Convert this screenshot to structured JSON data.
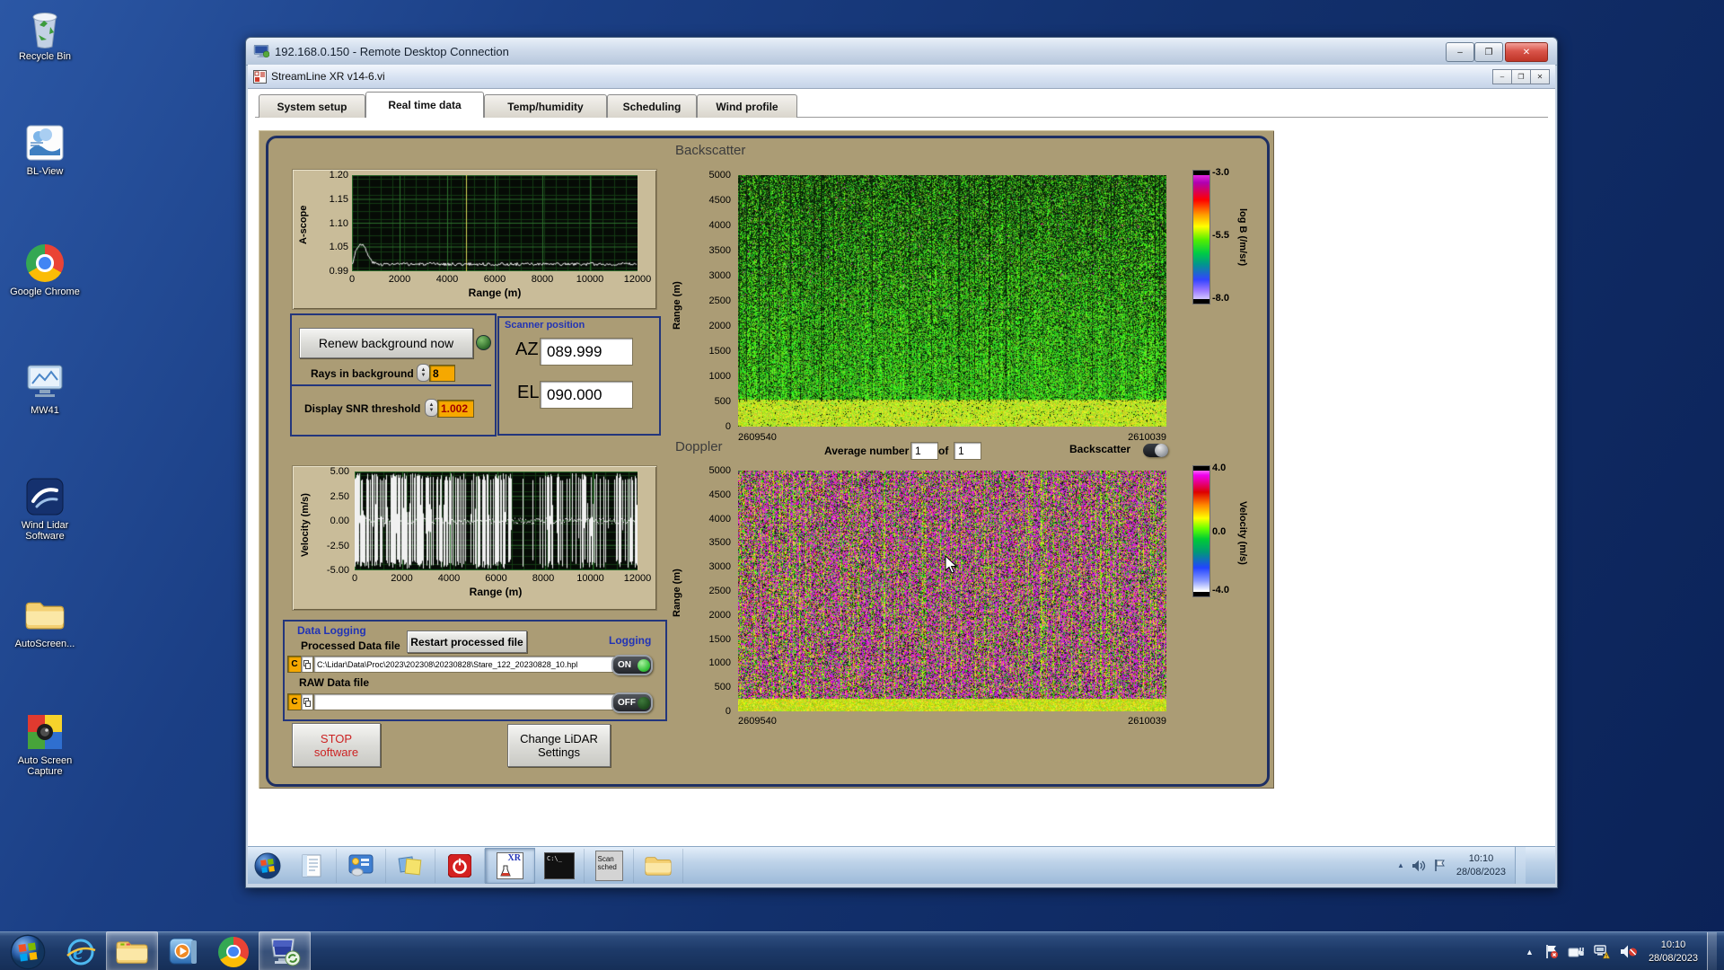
{
  "colors": {
    "panel_tan": "#ab9c75",
    "label_blue": "#2133b5",
    "field_orange": "#f6a800",
    "led_on_green": "#43e04a",
    "led_off_green": "#1d5c22",
    "plot_bg": "#060b06"
  },
  "desktop": {
    "icons": [
      {
        "label": "Recycle Bin"
      },
      {
        "label": "BL-View"
      },
      {
        "label": "Google Chrome"
      },
      {
        "label": "MW41"
      },
      {
        "label": "Wind Lidar Software"
      },
      {
        "label": "AutoScreen..."
      },
      {
        "label": "Auto Screen Capture"
      }
    ]
  },
  "rdp": {
    "title": "192.168.0.150 - Remote Desktop Connection"
  },
  "app": {
    "title": "StreamLine XR v14-6.vi",
    "tabs": [
      {
        "label": "System setup"
      },
      {
        "label": "Real time data"
      },
      {
        "label": "Temp/humidity"
      },
      {
        "label": "Scheduling"
      },
      {
        "label": "Wind profile"
      }
    ],
    "ascope": {
      "ylabel": "A-scope",
      "xlabel": "Range (m)",
      "yticks": [
        "1.20",
        "1.15",
        "1.10",
        "1.05",
        "0.99"
      ],
      "xticks": [
        "0",
        "2000",
        "4000",
        "6000",
        "8000",
        "10000",
        "12000"
      ]
    },
    "controls": {
      "renew": "Renew background now",
      "rays_label": "Rays in background",
      "rays_value": "8",
      "snr_label": "Display SNR threshold",
      "snr_value": "1.002"
    },
    "scanner": {
      "title": "Scanner position",
      "az_label": "AZ",
      "az_value": "089.999",
      "el_label": "EL",
      "el_value": "090.000"
    },
    "backscatter": {
      "title": "Backscatter",
      "ylabel": "Range (m)",
      "yticks": [
        "5000",
        "4500",
        "4000",
        "3500",
        "3000",
        "2500",
        "2000",
        "1500",
        "1000",
        "500",
        "0"
      ],
      "x_left": "2609540",
      "x_right": "2610039",
      "cb_ticks": [
        "-3.0",
        "-5.5",
        "-8.0"
      ],
      "cb_label": "log B (/m/sr)"
    },
    "doppler": {
      "title": "Doppler",
      "avg_label": "Average number",
      "avg_value": "1",
      "of_label": "of",
      "of_value": "1",
      "toggle_label": "Backscatter",
      "ylabel": "Range (m)",
      "yticks": [
        "5000",
        "4500",
        "4000",
        "3500",
        "3000",
        "2500",
        "2000",
        "1500",
        "1000",
        "500",
        "0"
      ],
      "x_left": "2609540",
      "x_right": "2610039",
      "cb_ticks": [
        "4.0",
        "0.0",
        "-4.0"
      ],
      "cb_label": "Velocity (m/s)"
    },
    "velocity": {
      "ylabel": "Velocity (m/s)",
      "xlabel": "Range (m)",
      "yticks": [
        "5.00",
        "2.50",
        "0.00",
        "-2.50",
        "-5.00"
      ],
      "xticks": [
        "0",
        "2000",
        "4000",
        "6000",
        "8000",
        "10000",
        "12000"
      ]
    },
    "logging": {
      "title": "Data Logging",
      "processed_label": "Processed Data file",
      "restart": "Restart processed file",
      "logging_label": "Logging",
      "drive": "C",
      "processed_path": "C:\\Lidar\\Data\\Proc\\2023\\202308\\20230828\\Stare_122_20230828_10.hpl",
      "on": "ON",
      "raw_label": "RAW Data file",
      "off": "OFF"
    },
    "stop_line1": "STOP",
    "stop_line2": "software",
    "change_line1": "Change LiDAR",
    "change_line2": "Settings"
  },
  "inner_taskbar": {
    "time": "10:10",
    "date": "28/08/2023",
    "cmd_text": "C:\\_",
    "scan_line1": "Scan",
    "scan_line2": "sched",
    "xr_text": "XR",
    "icons": [
      "start",
      "notepad",
      "system-settings",
      "sticky-notes",
      "shutdown",
      "streamline-xr",
      "command-prompt",
      "scan-scheduler",
      "file-explorer"
    ],
    "tray_icons": [
      "expand-arrow",
      "speaker",
      "flag"
    ]
  },
  "host_taskbar": {
    "time": "10:10",
    "date": "28/08/2023",
    "icons": [
      "start",
      "internet-explorer",
      "file-explorer",
      "media-player",
      "chrome",
      "remote-desktop"
    ],
    "tray_icons": [
      "expand-arrow",
      "action-center-flag",
      "battery",
      "network-warning",
      "speaker-muted"
    ]
  },
  "chart_data": [
    {
      "type": "line",
      "name": "A-scope",
      "xlabel": "Range (m)",
      "ylabel": "A-scope",
      "xlim": [
        0,
        12000
      ],
      "ylim": [
        0.99,
        1.2
      ],
      "x": [
        0,
        150,
        300,
        400,
        500,
        700,
        900,
        1100,
        1500,
        2000,
        3000,
        4000,
        5000,
        6000,
        7000,
        8000,
        9000,
        10000,
        11000,
        12000
      ],
      "y": [
        1.005,
        1.035,
        1.044,
        1.046,
        1.04,
        1.02,
        1.008,
        1.002,
        0.999,
        1.0,
        0.999,
        1.0,
        1.0,
        0.999,
        1.0,
        1.0,
        0.999,
        1.0,
        1.0,
        0.999
      ],
      "cursor_x": 4800,
      "grid": true,
      "note": "white noisy trace, bump to ~1.045 near 300-500 m then flat ~1.00"
    },
    {
      "type": "heatmap",
      "name": "Backscatter",
      "x_range": [
        2609540,
        2610039
      ],
      "y_range": [
        0,
        5000
      ],
      "ylabel": "Range (m)",
      "z_label": "log B (/m/sr)",
      "z_range": [
        -8.0,
        -3.0
      ],
      "note": "speckled green field (~ -5.5) with black speckle increasing aloft; bright yellow-green layer below ~500 m; sparse magenta dots"
    },
    {
      "type": "heatmap",
      "name": "Doppler",
      "x_range": [
        2609540,
        2610039
      ],
      "y_range": [
        0,
        5000
      ],
      "ylabel": "Range (m)",
      "z_label": "Velocity (m/s)",
      "z_range": [
        -4.0,
        4.0
      ],
      "averaging": {
        "average_number": 1,
        "of": 1
      },
      "note": "noisy magenta field with vertical green/yellow streaks; coherent yellow-green band below ~500 m"
    },
    {
      "type": "line",
      "name": "Velocity",
      "xlabel": "Range (m)",
      "ylabel": "Velocity (m/s)",
      "xlim": [
        0,
        12000
      ],
      "ylim": [
        -5,
        5
      ],
      "note": "dense full-scale noise spikes across most ranges; quieter gaps near 6800-7600 m and 8400-9200 m",
      "grid": true
    }
  ]
}
